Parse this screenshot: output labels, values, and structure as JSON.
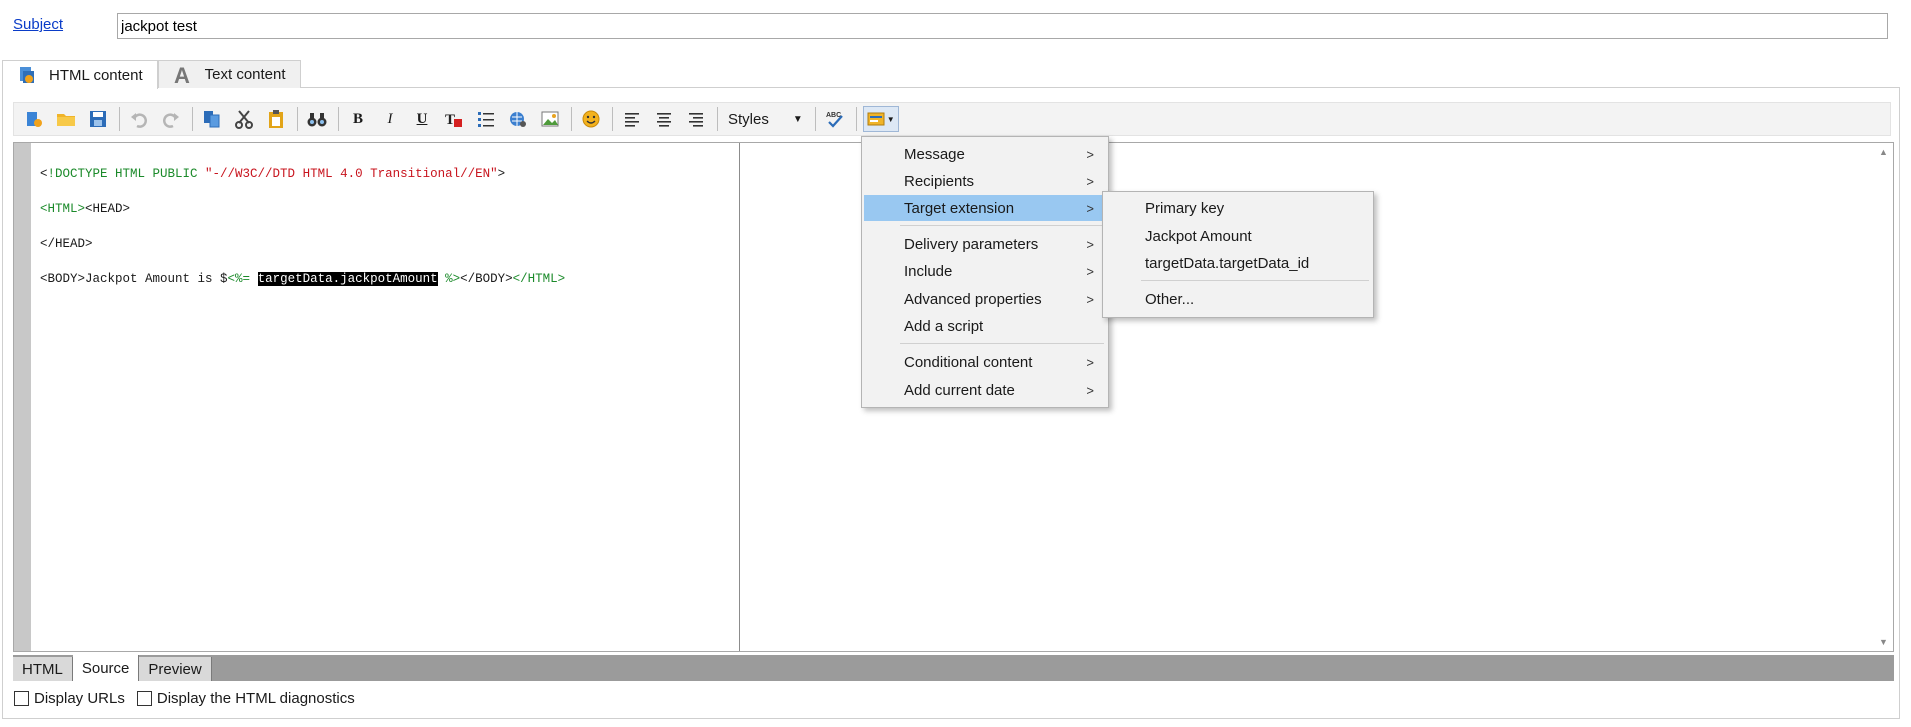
{
  "subject": {
    "label": "Subject",
    "value": "jackpot test"
  },
  "tabs": [
    {
      "label": "HTML content",
      "icon": "html-doc-icon",
      "active": true
    },
    {
      "label": "Text content",
      "icon": "text-a-icon",
      "active": false
    }
  ],
  "toolbar": {
    "styles_label": "Styles"
  },
  "code": {
    "line1": {
      "a": "<",
      "b": "!DOCTYPE HTML PUBLIC ",
      "c": "\"-//W3C//DTD HTML 4.0 Transitional//EN\"",
      "d": ">"
    },
    "line2": {
      "a": "<HTML>",
      "b": "<HEAD>"
    },
    "line3": "</HEAD>",
    "line4": {
      "a": "<BODY>Jackpot Amount is $",
      "b": "<%=",
      "c": " ",
      "sel": "targetData.jackpotAmount",
      "d": " %>",
      "e": "</BODY>",
      "f": "</HTML>"
    }
  },
  "bottom_tabs": [
    {
      "label": "HTML",
      "active": false
    },
    {
      "label": "Source",
      "active": true
    },
    {
      "label": "Preview",
      "active": false
    }
  ],
  "checkboxes": [
    {
      "label": "Display URLs",
      "checked": false
    },
    {
      "label": "Display the HTML diagnostics",
      "checked": false
    }
  ],
  "menu": {
    "items": [
      {
        "label": "Message",
        "submenu": true
      },
      {
        "label": "Recipients",
        "submenu": true
      },
      {
        "label": "Target extension",
        "submenu": true,
        "highlighted": true
      },
      {
        "label": "Delivery parameters",
        "submenu": true
      },
      {
        "label": "Include",
        "submenu": true
      },
      {
        "label": "Advanced properties",
        "submenu": true
      },
      {
        "label": "Add a script",
        "submenu": false
      },
      {
        "label": "Conditional content",
        "submenu": true
      },
      {
        "label": "Add current date",
        "submenu": true
      }
    ],
    "submenu_items": [
      {
        "label": "Primary key"
      },
      {
        "label": "Jackpot Amount"
      },
      {
        "label": "targetData.targetData_id"
      },
      {
        "label": "Other..."
      }
    ],
    "submenu_arrow": ">"
  },
  "colors": {
    "highlight": "#99c8f1",
    "code_tag": "#1b8a2a",
    "code_string": "#c8141e",
    "link": "#0a3cc8"
  }
}
